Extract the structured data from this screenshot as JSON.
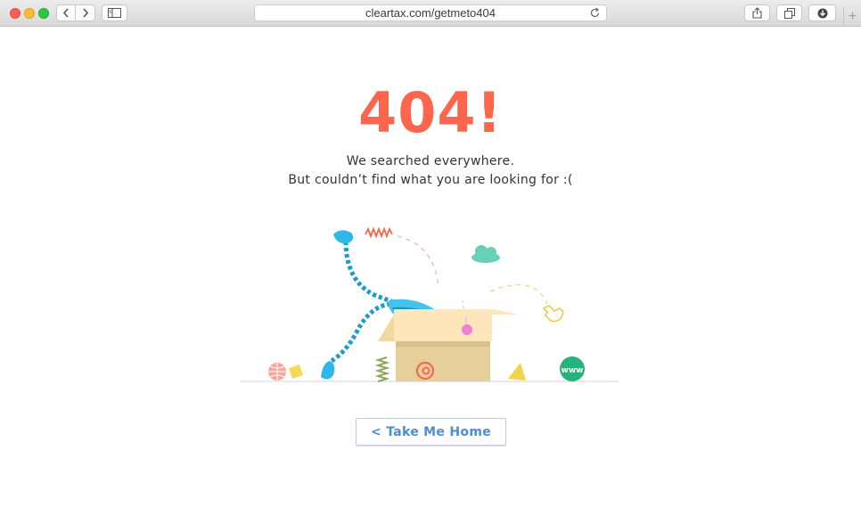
{
  "browser": {
    "url": "cleartax.com/getmeto404",
    "new_tab": "+"
  },
  "page": {
    "title": "404!",
    "message_line1": "We searched everywhere.",
    "message_line2": "But couldn’t find what you are looking for :(",
    "home_button": "< Take Me Home"
  },
  "illustration": {
    "badge_text": "www"
  },
  "colors": {
    "accent": "#fd664c",
    "button_text": "#4c8ed2",
    "text": "#333333"
  }
}
